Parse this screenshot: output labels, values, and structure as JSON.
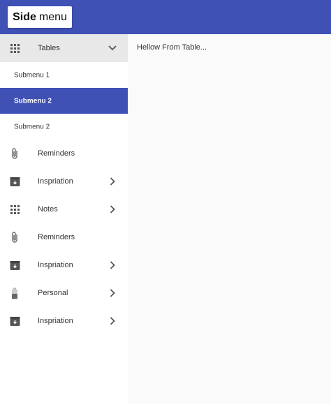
{
  "header": {
    "brand_bold": "Side",
    "brand_light": "menu",
    "background": "#3f51b5"
  },
  "sidebar": {
    "expanded_item": {
      "label": "Tables",
      "icon": "apps-grid-icon"
    },
    "submenu": [
      {
        "label": "Submenu 1",
        "active": false
      },
      {
        "label": "Submenu 2",
        "active": true
      },
      {
        "label": "Submenu 2",
        "active": false
      }
    ],
    "items": [
      {
        "label": "Reminders",
        "icon": "paperclip-icon",
        "has_chevron": false
      },
      {
        "label": "Inspriation",
        "icon": "archive-icon",
        "has_chevron": true
      },
      {
        "label": "Notes",
        "icon": "apps-grid-icon",
        "has_chevron": true
      },
      {
        "label": "Reminders",
        "icon": "paperclip-icon",
        "has_chevron": false
      },
      {
        "label": "Inspriation",
        "icon": "archive-icon",
        "has_chevron": true
      },
      {
        "label": "Personal",
        "icon": "battery-icon",
        "has_chevron": true
      },
      {
        "label": "Inspriation",
        "icon": "archive-icon",
        "has_chevron": true
      }
    ]
  },
  "main": {
    "content_text": "Hellow From Table..."
  },
  "colors": {
    "accent": "#3f51b5",
    "expanded_bg": "#e8e8e8",
    "main_bg": "#fafafa"
  }
}
